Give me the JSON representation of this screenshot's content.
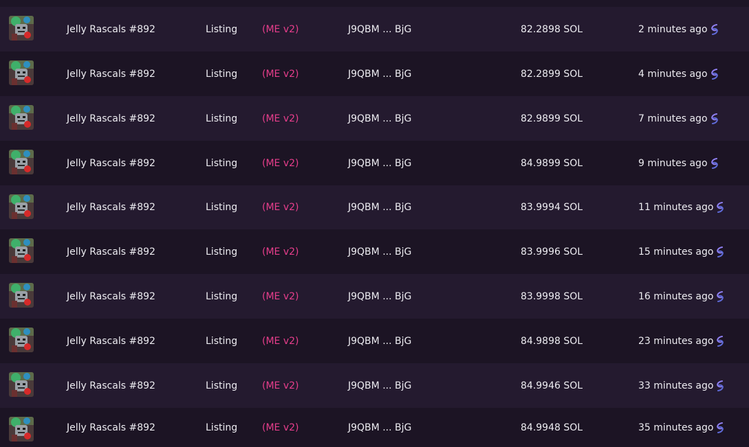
{
  "activity": {
    "rows": [
      {
        "name": "Jelly Rascals #892",
        "type": "Listing",
        "marketplace": "(ME v2)",
        "seller": "J9QBM ... BjG",
        "price": "82.2898 SOL",
        "time": "2 minutes ago"
      },
      {
        "name": "Jelly Rascals #892",
        "type": "Listing",
        "marketplace": "(ME v2)",
        "seller": "J9QBM ... BjG",
        "price": "82.2899 SOL",
        "time": "4 minutes ago"
      },
      {
        "name": "Jelly Rascals #892",
        "type": "Listing",
        "marketplace": "(ME v2)",
        "seller": "J9QBM ... BjG",
        "price": "82.9899 SOL",
        "time": "7 minutes ago"
      },
      {
        "name": "Jelly Rascals #892",
        "type": "Listing",
        "marketplace": "(ME v2)",
        "seller": "J9QBM ... BjG",
        "price": "84.9899 SOL",
        "time": "9 minutes ago"
      },
      {
        "name": "Jelly Rascals #892",
        "type": "Listing",
        "marketplace": "(ME v2)",
        "seller": "J9QBM ... BjG",
        "price": "83.9994 SOL",
        "time": "11 minutes ago"
      },
      {
        "name": "Jelly Rascals #892",
        "type": "Listing",
        "marketplace": "(ME v2)",
        "seller": "J9QBM ... BjG",
        "price": "83.9996 SOL",
        "time": "15 minutes ago"
      },
      {
        "name": "Jelly Rascals #892",
        "type": "Listing",
        "marketplace": "(ME v2)",
        "seller": "J9QBM ... BjG",
        "price": "83.9998 SOL",
        "time": "16 minutes ago"
      },
      {
        "name": "Jelly Rascals #892",
        "type": "Listing",
        "marketplace": "(ME v2)",
        "seller": "J9QBM ... BjG",
        "price": "84.9898 SOL",
        "time": "23 minutes ago"
      },
      {
        "name": "Jelly Rascals #892",
        "type": "Listing",
        "marketplace": "(ME v2)",
        "seller": "J9QBM ... BjG",
        "price": "84.9946 SOL",
        "time": "33 minutes ago"
      },
      {
        "name": "Jelly Rascals #892",
        "type": "Listing",
        "marketplace": "(ME v2)",
        "seller": "J9QBM ... BjG",
        "price": "84.9948 SOL",
        "time": "35 minutes ago"
      }
    ],
    "icon": "solana-icon",
    "colors": {
      "row_alt": "#241a2f",
      "row_base": "#1c1424",
      "marketplace": "#e83e8c",
      "text": "#ecebf0"
    }
  }
}
